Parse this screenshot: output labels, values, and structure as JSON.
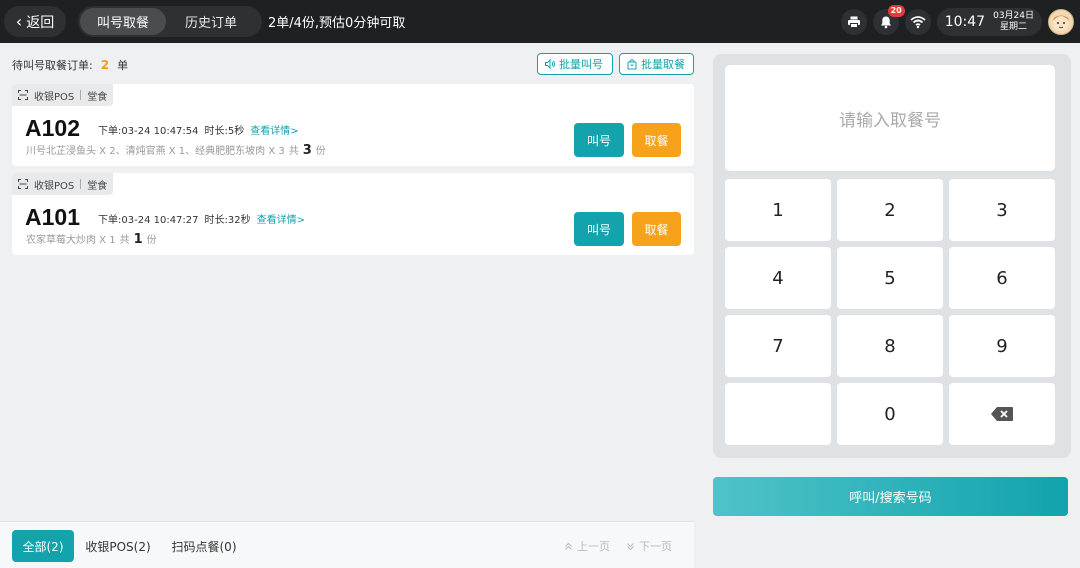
{
  "header": {
    "back_label": "返回",
    "tabs": [
      {
        "label": "叫号取餐",
        "active": true
      },
      {
        "label": "历史订单",
        "active": false
      }
    ],
    "summary": "2单/4份,预估0分钟可取",
    "notification_count": "20",
    "time": "10:47",
    "date": "03月24日",
    "weekday": "星期二"
  },
  "list": {
    "pending_label": "待叫号取餐订单:",
    "pending_count": "2",
    "pending_unit": "单",
    "batch_call_label": "批量叫号",
    "batch_pickup_label": "批量取餐"
  },
  "orders": [
    {
      "tag_source": "收银POS",
      "tag_type": "堂食",
      "number": "A102",
      "order_time": "下单:03-24 10:47:54",
      "duration": "时长:5秒",
      "detail_link": "查看详情>",
      "items": "川号北芷浸鱼头 X 2、清炖官燕 X 1、经典肥肥东坡肉 X 3",
      "total_prefix": "共",
      "total_qty": "3",
      "total_unit": "份",
      "call_label": "叫号",
      "pickup_label": "取餐"
    },
    {
      "tag_source": "收银POS",
      "tag_type": "堂食",
      "number": "A101",
      "order_time": "下单:03-24 10:47:27",
      "duration": "时长:32秒",
      "detail_link": "查看详情>",
      "items": "农家草莓大炒肉 X 1",
      "total_prefix": "共",
      "total_qty": "1",
      "total_unit": "份",
      "call_label": "叫号",
      "pickup_label": "取餐"
    }
  ],
  "filters": [
    {
      "label": "全部(2)",
      "active": true
    },
    {
      "label": "收银POS(2)",
      "active": false
    },
    {
      "label": "扫码点餐(0)",
      "active": false
    }
  ],
  "pager": {
    "prev_label": "上一页",
    "next_label": "下一页"
  },
  "keypad": {
    "placeholder": "请输入取餐号",
    "keys": [
      "1",
      "2",
      "3",
      "4",
      "5",
      "6",
      "7",
      "8",
      "9",
      "",
      "0",
      "⌫"
    ],
    "submit_label": "呼叫/搜索号码"
  },
  "colors": {
    "accent": "#12a3ad",
    "orange": "#f7a21b",
    "topbar": "#1f2022"
  }
}
